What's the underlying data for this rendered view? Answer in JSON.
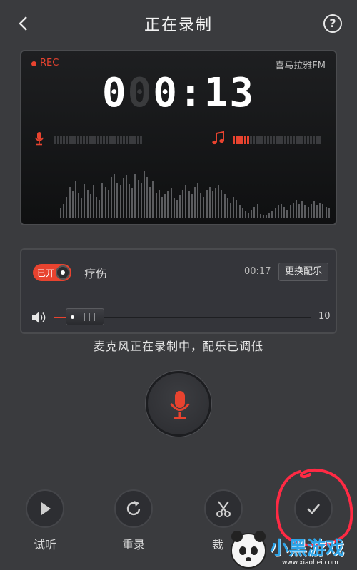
{
  "header": {
    "title": "正在录制",
    "help_label": "?"
  },
  "recorder": {
    "rec_label": "REC",
    "brand": "喜马拉雅FM",
    "timer": {
      "dim_digit": "0",
      "main": "0:13",
      "prefix": "0"
    },
    "mic_level_fraction": 0.0,
    "music_level_fraction": 0.2
  },
  "music": {
    "toggle_label": "已开",
    "toggle_on": true,
    "song_name": "疗伤",
    "song_time": "00:17",
    "change_button": "更换配乐",
    "volume_value": "10"
  },
  "status_text": "麦克风正在录制中，配乐已调低",
  "actions": [
    {
      "label": "试听",
      "icon": "play-icon"
    },
    {
      "label": "重录",
      "icon": "redo-icon"
    },
    {
      "label": "裁",
      "icon": "scissors-icon"
    },
    {
      "label": "",
      "icon": "check-icon"
    }
  ],
  "watermark": {
    "text": "小黑游戏",
    "url": "www.xiaohei.com"
  },
  "colors": {
    "accent": "#e8432f",
    "background": "#3a3b3e",
    "panel": "#16171a"
  }
}
